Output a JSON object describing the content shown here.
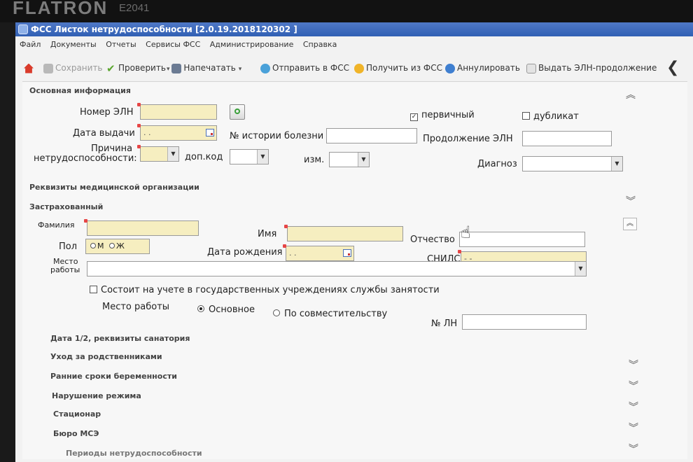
{
  "monitor": {
    "brand": "FLATRON",
    "model": "E2041"
  },
  "window": {
    "title": "ФСС Листок нетрудоспособности [2.0.19.2018120302 ]"
  },
  "menu": [
    "Файл",
    "Документы",
    "Отчеты",
    "Сервисы ФСС",
    "Администрирование",
    "Справка"
  ],
  "toolbar": {
    "save": "Сохранить",
    "check": "Проверить",
    "print": "Напечатать",
    "send": "Отправить в ФСС",
    "receive": "Получить из ФСС",
    "annul": "Аннулировать",
    "issue_continuation": "Выдать ЭЛН-продолжение",
    "back": "❮"
  },
  "sections": {
    "main_info": "Основная информация",
    "med_org": "Реквизиты медицинской организации",
    "insured": "Застрахованный",
    "dates": "Дата 1/2, реквизиты санатория",
    "care": "Уход за родственниками",
    "pregnancy": "Ранние сроки беременности",
    "regime": "Нарушение режима",
    "hospital": "Стационар",
    "mse": "Бюро МСЭ",
    "periods": "Периоды нетрудоспособности"
  },
  "main": {
    "eln_label": "Номер ЭЛН",
    "issue_date_label": "Дата выдачи",
    "issue_date_placeholder": ". .",
    "history_label": "№ истории болезни",
    "continuation_label": "Продолжение ЭЛН",
    "reason_label_1": "Причина",
    "reason_label_2": "нетрудоспособности:",
    "extra_code_label": "доп.код",
    "change_label": "изм.",
    "diagnosis_label": "Диагноз",
    "primary_label": "первичный",
    "primary_checked": true,
    "duplicate_label": "дубликат",
    "duplicate_checked": false
  },
  "insured": {
    "surname_label": "Фамилия",
    "name_label": "Имя",
    "patronymic_label": "Отчество",
    "gender_label": "Пол",
    "gender_m": "М",
    "gender_f": "Ж",
    "birth_label": "Дата рождения",
    "birth_placeholder": ". .",
    "snils_label": "СНИЛС",
    "snils_placeholder": "- -",
    "work_label_1": "Место",
    "work_label_2": "работы",
    "employment_service": "Состоит на учете в государственных учреждениях службы занятости",
    "work_type_label": "Место работы",
    "work_main": "Основное",
    "work_main_selected": true,
    "work_part": "По совместительству",
    "ln_label": "№ ЛН"
  }
}
